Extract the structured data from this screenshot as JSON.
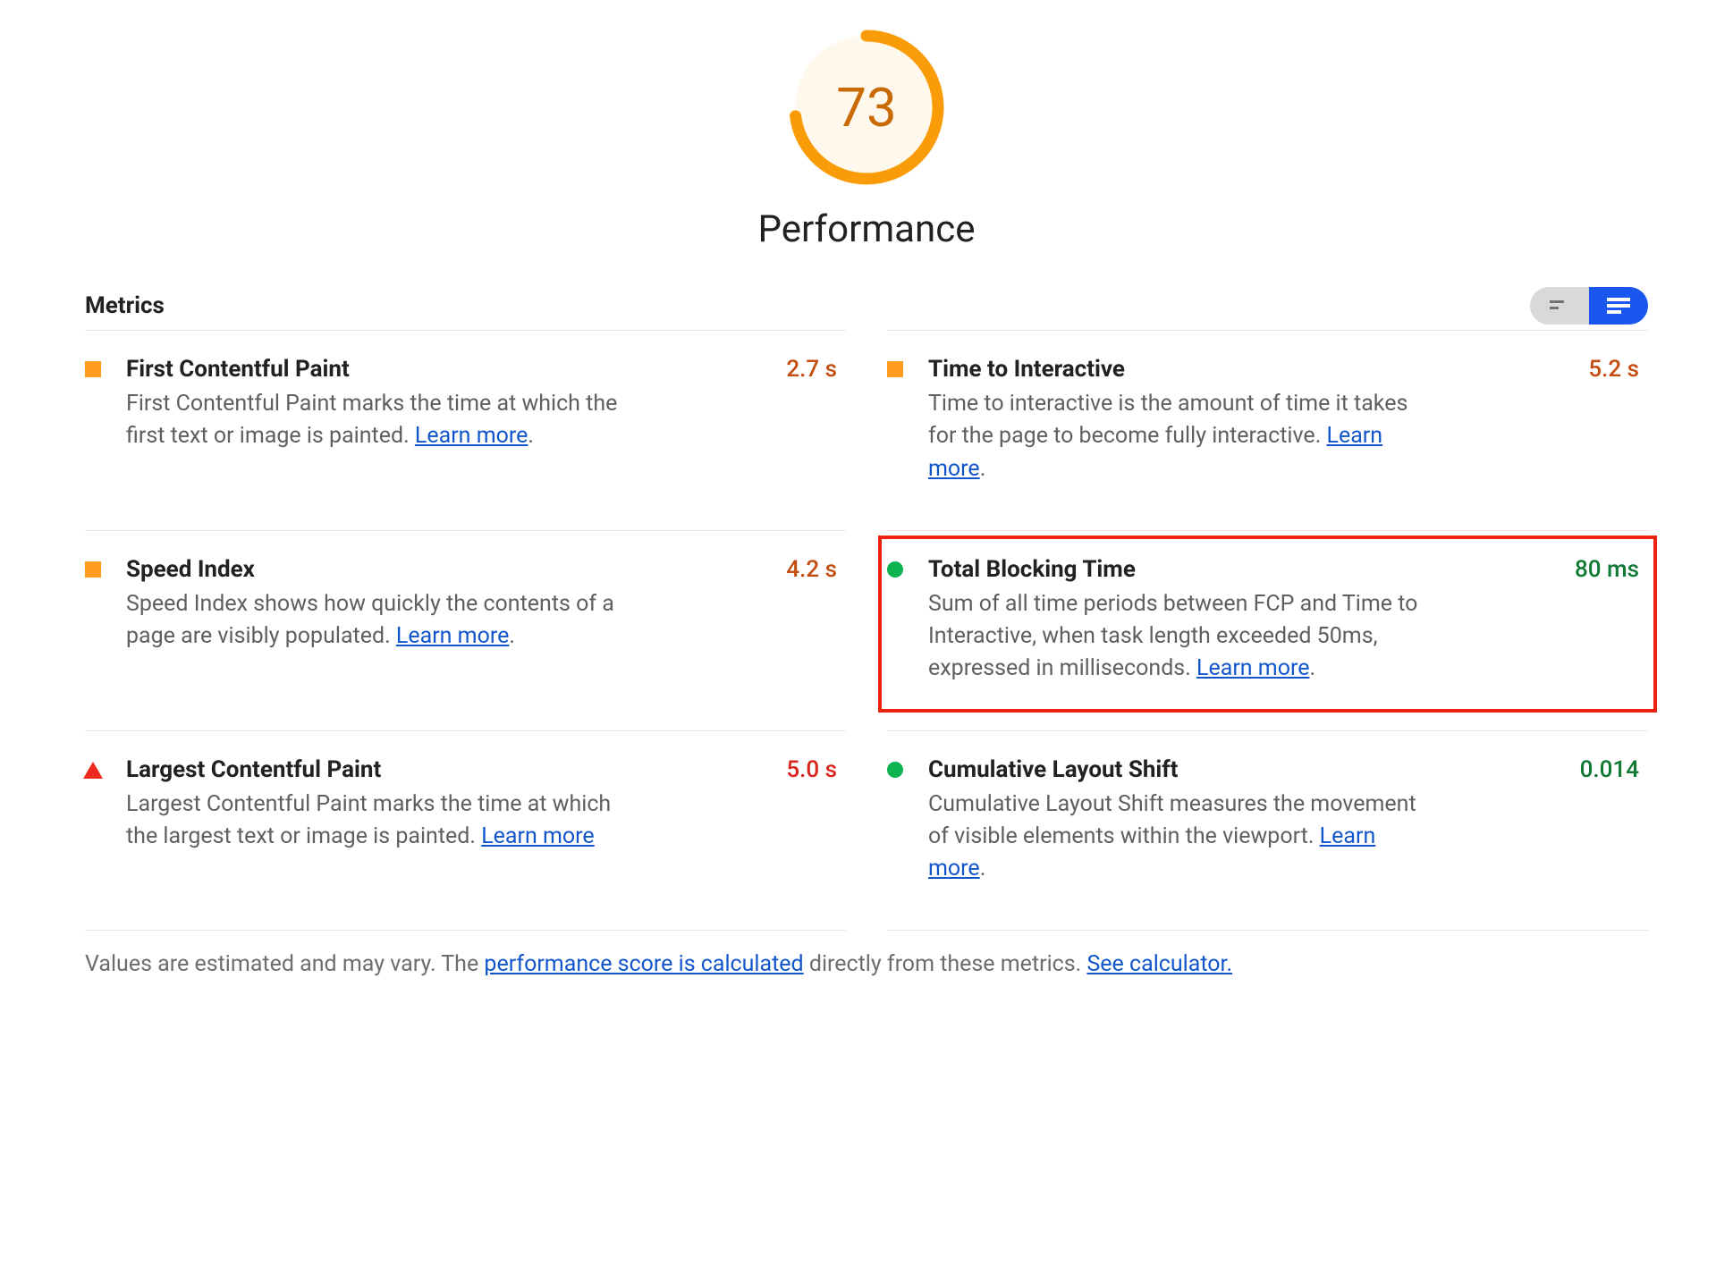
{
  "header": {
    "score": "73",
    "title": "Performance",
    "score_percent": 73
  },
  "metrics_section": {
    "label": "Metrics"
  },
  "metrics": [
    {
      "id": "fcp",
      "status": "average",
      "name": "First Contentful Paint",
      "value": "2.7 s",
      "value_class": "val-orange",
      "desc_pre": "First Contentful Paint marks the time at which the first text or image is painted. ",
      "learn": "Learn more",
      "desc_post": "."
    },
    {
      "id": "tti",
      "status": "average",
      "name": "Time to Interactive",
      "value": "5.2 s",
      "value_class": "val-orange",
      "desc_pre": "Time to interactive is the amount of time it takes for the page to become fully interactive. ",
      "learn": "Learn more",
      "desc_post": "."
    },
    {
      "id": "si",
      "status": "average",
      "name": "Speed Index",
      "value": "4.2 s",
      "value_class": "val-orange",
      "desc_pre": "Speed Index shows how quickly the contents of a page are visibly populated. ",
      "learn": "Learn more",
      "desc_post": "."
    },
    {
      "id": "tbt",
      "status": "good",
      "name": "Total Blocking Time",
      "value": "80 ms",
      "value_class": "val-green",
      "desc_pre": "Sum of all time periods between FCP and Time to Interactive, when task length exceeded 50ms, expressed in milliseconds. ",
      "learn": "Learn more",
      "desc_post": ".",
      "highlighted": true
    },
    {
      "id": "lcp",
      "status": "poor",
      "name": "Largest Contentful Paint",
      "value": "5.0 s",
      "value_class": "val-red",
      "desc_pre": "Largest Contentful Paint marks the time at which the largest text or image is painted. ",
      "learn": "Learn more",
      "desc_post": ""
    },
    {
      "id": "cls",
      "status": "good",
      "name": "Cumulative Layout Shift",
      "value": "0.014",
      "value_class": "val-green",
      "desc_pre": "Cumulative Layout Shift measures the movement of visible elements within the viewport. ",
      "learn": "Learn more",
      "desc_post": "."
    }
  ],
  "footer": {
    "pre": "Values are estimated and may vary. The ",
    "link1": "performance score is calculated",
    "mid": " directly from these metrics. ",
    "link2": "See calculator."
  }
}
